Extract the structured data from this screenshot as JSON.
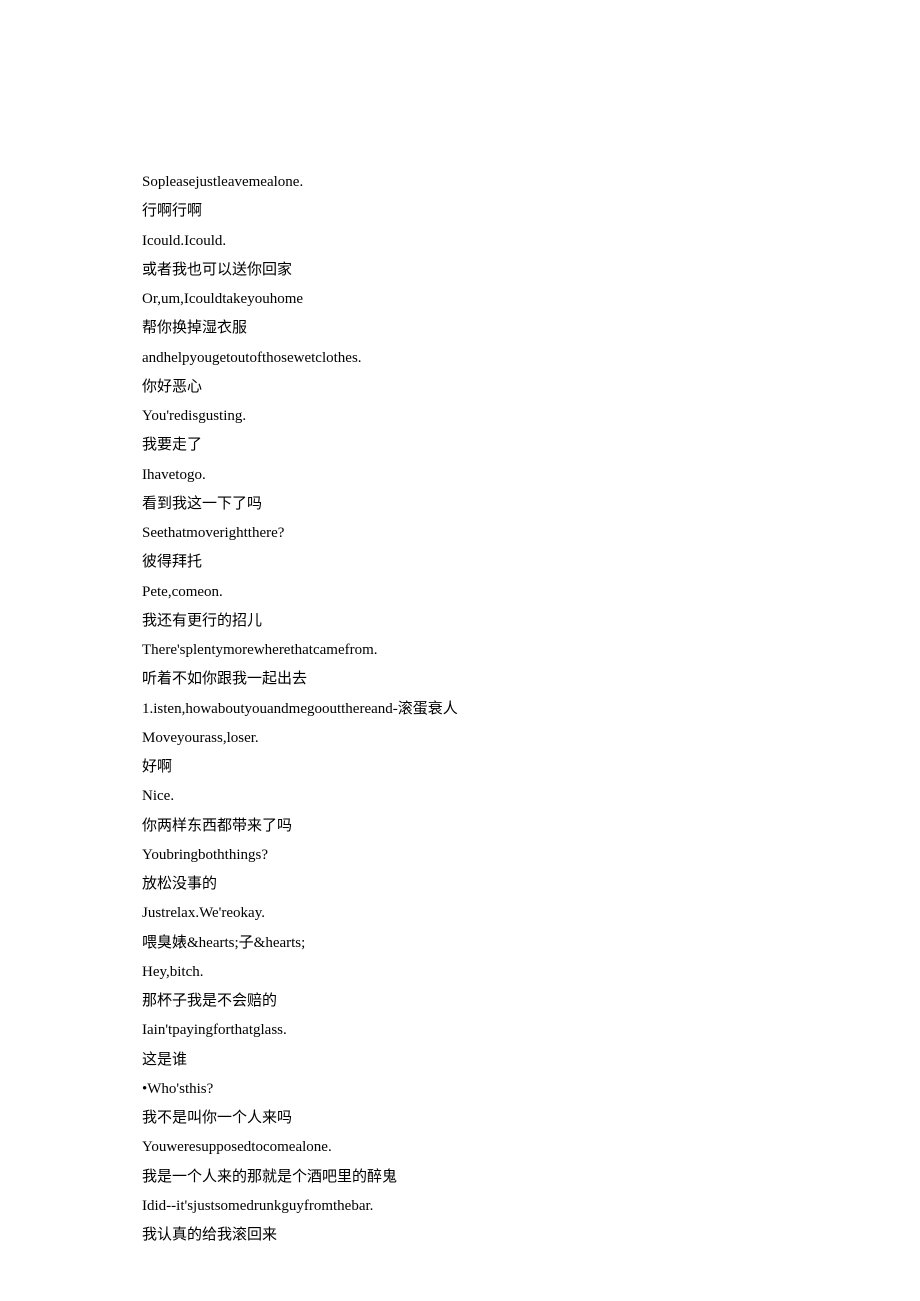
{
  "lines": [
    "Sopleasejustleavemealone.",
    "行啊行啊",
    "Icould.Icould.",
    "或者我也可以送你回家",
    "Or,um,Icouldtakeyouhome",
    "帮你换掉湿衣服",
    "andhelpyougetoutofthosewetclothes.",
    "你好恶心",
    "You'redisgusting.",
    "我要走了",
    "Ihavetogo.",
    "看到我这一下了吗",
    "Seethatmoverightthere?",
    "彼得拜托",
    "Pete,comeon.",
    "我还有更行的招儿",
    "There'splentymorewherethatcamefrom.",
    "听着不如你跟我一起出去",
    "1.isten,howaboutyouandmegooutthereand-滚蛋衰人",
    "Moveyourass,loser.",
    "好啊",
    "Nice.",
    "你两样东西都带来了吗",
    "Youbringboththings?",
    "放松没事的",
    "Justrelax.We'reokay.",
    "喂臭婊&hearts;子&hearts;",
    "Hey,bitch.",
    "那杯子我是不会赔的",
    "Iain'tpayingforthatglass.",
    "这是谁",
    "•Who'sthis?",
    "我不是叫你一个人来吗",
    "Youweresupposedtocomealone.",
    "我是一个人来的那就是个酒吧里的醉鬼",
    "Idid--it'sjustsomedrunkguyfromthebar.",
    "我认真的给我滚回来"
  ]
}
